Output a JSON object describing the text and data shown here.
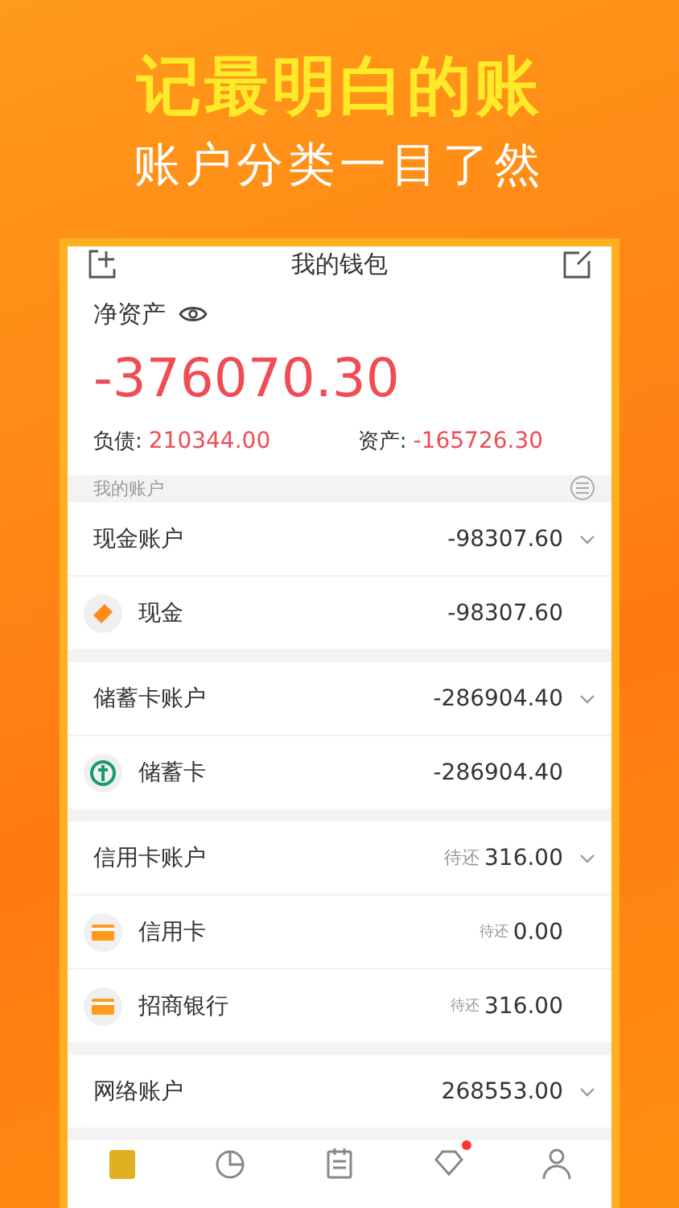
{
  "headline": "记最明白的账",
  "subheadline": "账户分类一目了然",
  "header": {
    "title": "我的钱包"
  },
  "net_assets": {
    "label": "净资产",
    "amount": "-376070.30",
    "liabilities_label": "负债:",
    "liabilities": "210344.00",
    "assets_label": "资产:",
    "assets": "-165726.30"
  },
  "section_label": "我的账户",
  "groups": [
    {
      "name": "现金账户",
      "amount": "-98307.60",
      "items": [
        {
          "kind": "cash",
          "name": "现金",
          "amount": "-98307.60"
        }
      ]
    },
    {
      "name": "储蓄卡账户",
      "amount": "-286904.40",
      "items": [
        {
          "kind": "bank",
          "name": "储蓄卡",
          "amount": "-286904.40"
        }
      ]
    },
    {
      "name": "信用卡账户",
      "prefix": "待还",
      "amount": "316.00",
      "items": [
        {
          "kind": "card",
          "name": "信用卡",
          "prefix": "待还",
          "amount": "0.00"
        },
        {
          "kind": "card",
          "name": "招商银行",
          "prefix": "待还",
          "amount": "316.00"
        }
      ]
    },
    {
      "name": "网络账户",
      "amount": "268553.00"
    }
  ],
  "tabs": [
    {
      "kind": "wallet",
      "selected": true,
      "badge": false
    },
    {
      "kind": "chart",
      "selected": false,
      "badge": false
    },
    {
      "kind": "calendar",
      "selected": false,
      "badge": false
    },
    {
      "kind": "diamond",
      "selected": false,
      "badge": true
    },
    {
      "kind": "person",
      "selected": false,
      "badge": false
    }
  ]
}
